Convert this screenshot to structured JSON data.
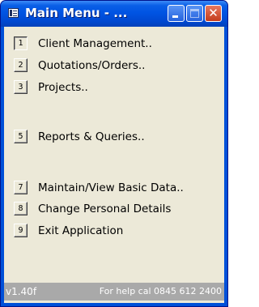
{
  "window": {
    "title": "Main Menu - ...",
    "controls": {
      "minimize_icon": "minimize-icon",
      "maximize_icon": "maximize-icon",
      "close_glyph": "✕"
    }
  },
  "menu": {
    "items": [
      {
        "key": "1",
        "label": "Client Management.."
      },
      {
        "key": "2",
        "label": "Quotations/Orders.."
      },
      {
        "key": "3",
        "label": "Projects.."
      },
      {
        "key": "5",
        "label": "Reports & Queries.."
      },
      {
        "key": "7",
        "label": "Maintain/View Basic Data.."
      },
      {
        "key": "8",
        "label": "Change Personal Details"
      },
      {
        "key": "9",
        "label": "Exit Application"
      }
    ]
  },
  "status": {
    "version": "v1.40f",
    "help": "For help cal 0845 612 2400"
  },
  "colors": {
    "titlebar": "#0054e3",
    "client_bg": "#ece9d8",
    "status_bg": "#a9a9a9"
  }
}
